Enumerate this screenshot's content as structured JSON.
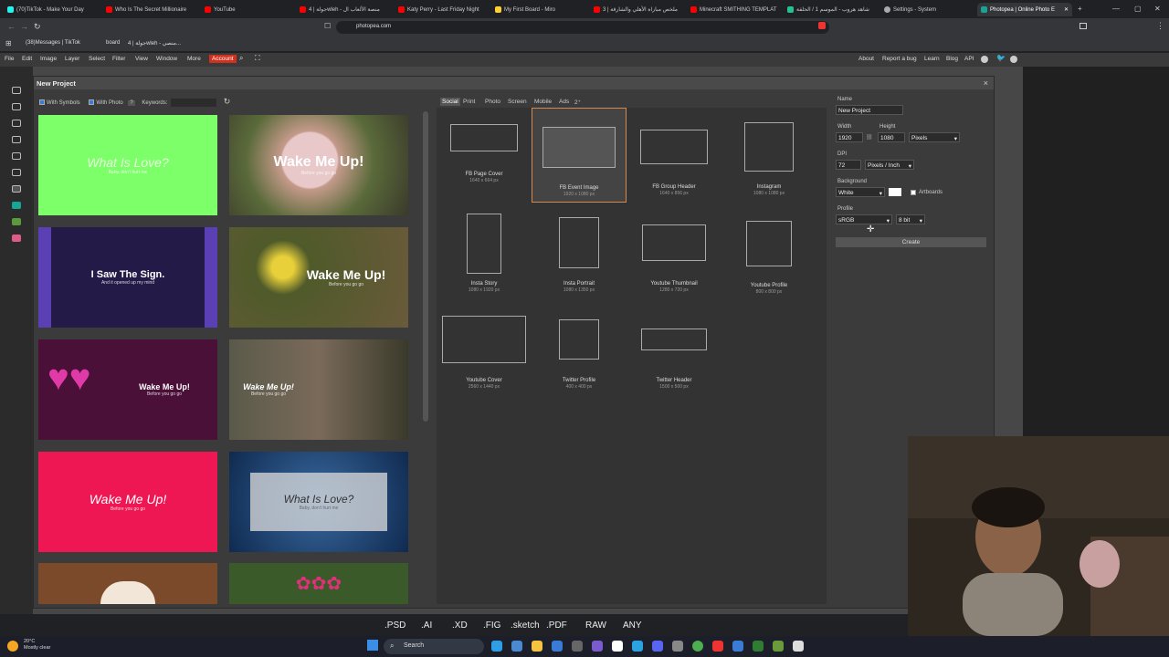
{
  "browser": {
    "tabs": [
      {
        "label": "(70)TikTok - Make Your Day",
        "color": "#25f4ee"
      },
      {
        "label": "Who Is The Secret Millionaire",
        "color": "#ff0000"
      },
      {
        "label": "YouTube",
        "color": "#ff0000"
      },
      {
        "label": "جولة | 4wleh - منصة الألعاب ال",
        "color": "#ff0000"
      },
      {
        "label": "Katy Perry - Last Friday Night",
        "color": "#ff0000"
      },
      {
        "label": "My First Board - Miro",
        "color": "#ffd02f"
      },
      {
        "label": "ملخص مباراة الأهلي والشارقة | 3",
        "color": "#ff0000"
      },
      {
        "label": "Minecraft SMITHING TEMPLAT",
        "color": "#ff0000"
      },
      {
        "label": "شاهد هروب - الموسم 1 / الحلقة",
        "color": "#22c38e"
      },
      {
        "label": "Settings - System",
        "color": "#aaaaaa"
      },
      {
        "label": "Photopea | Online Photo E",
        "color": "#18a497"
      }
    ],
    "url": "photopea.com",
    "bookmarks": [
      "(38)Messages | TikTok",
      "board",
      "جولة | 4wleh - منصي..."
    ]
  },
  "menu": {
    "items": [
      "File",
      "Edit",
      "Image",
      "Layer",
      "Select",
      "Filter",
      "View",
      "Window",
      "More"
    ],
    "account": "Account",
    "right_items": [
      "About",
      "Report a bug",
      "Learn",
      "Blog",
      "API"
    ]
  },
  "dialog": {
    "title": "New Project",
    "close": "×",
    "with_symbols": "With Symbols",
    "with_photo": "With Photo",
    "help": "?",
    "keywords_label": "Keywords:",
    "templates": [
      {
        "text": "What Is Love?",
        "sub": "Baby, don't hurt me",
        "bg": "#7dff6a",
        "fg": "#e8ffe0"
      },
      {
        "text": "Wake Me Up!",
        "sub": "Before you go go",
        "bg": "#6b5a4e",
        "fg": "#ffffff"
      },
      {
        "text": "I Saw The Sign.",
        "sub": "And it opened up my mind",
        "bg": "#241a47",
        "fg": "#ffffff"
      },
      {
        "text": "Wake Me Up!",
        "sub": "Before you go go",
        "bg": "#4f5a2a",
        "fg": "#ffffff"
      },
      {
        "text": "Wake Me Up!",
        "sub": "Before you go go",
        "bg": "#4a1038",
        "fg": "#ffffff"
      },
      {
        "text": "Wake Me Up!",
        "sub": "Before you go go",
        "bg": "#5a5a4a",
        "fg": "#ffffff"
      },
      {
        "text": "Wake Me Up!",
        "sub": "Before you go go",
        "bg": "#ef1753",
        "fg": "#ffffff"
      },
      {
        "text": "What Is Love?",
        "sub": "Baby, don't hurt me",
        "bg": "#1b3a6a",
        "fg": "#ffffff"
      },
      {
        "text": "",
        "sub": "",
        "bg": "#7a4a2a",
        "fg": "#ffffff"
      },
      {
        "text": "",
        "sub": "",
        "bg": "#3a5a2a",
        "fg": "#ffffff"
      }
    ],
    "categories": [
      "Social",
      "Print",
      "Photo",
      "Screen",
      "Mobile",
      "Ads",
      "2⁺"
    ],
    "presets": [
      {
        "name": "FB Page Cover",
        "dim": "1640 x 664 px"
      },
      {
        "name": "FB Event Image",
        "dim": "1920 x 1080 px"
      },
      {
        "name": "FB Group Header",
        "dim": "1640 x 856 px"
      },
      {
        "name": "Instagram",
        "dim": "1080 x 1080 px"
      },
      {
        "name": "Insta Story",
        "dim": "1080 x 1920 px"
      },
      {
        "name": "Insta Portrait",
        "dim": "1080 x 1350 px"
      },
      {
        "name": "Youtube Thumbnail",
        "dim": "1280 x 720 px"
      },
      {
        "name": "Youtube Profile",
        "dim": "800 x 800 px"
      },
      {
        "name": "Youtube Cover",
        "dim": "2560 x 1440 px"
      },
      {
        "name": "Twitter Profile",
        "dim": "400 x 400 px"
      },
      {
        "name": "Twitter Header",
        "dim": "1500 x 500 px"
      }
    ],
    "right": {
      "name_label": "Name",
      "name_value": "New Project",
      "width_label": "Width",
      "height_label": "Height",
      "width_value": "1920",
      "height_value": "1080",
      "unit": "Pixels",
      "dpi_label": "DPI",
      "dpi_value": "72",
      "dpi_unit": "Pixels / Inch",
      "background_label": "Background",
      "background_value": "White",
      "artboards": "Artboards",
      "profile_label": "Profile",
      "profile_value": "sRGB",
      "bit_value": "8 bit",
      "create": "Create"
    }
  },
  "formats": [
    ".PSD",
    ".AI",
    ".XD",
    ".FIG",
    ".sketch",
    ".PDF",
    "RAW",
    "ANY"
  ],
  "taskbar": {
    "temp": "20°C",
    "weather": "Mostly clear",
    "search": "Search"
  }
}
